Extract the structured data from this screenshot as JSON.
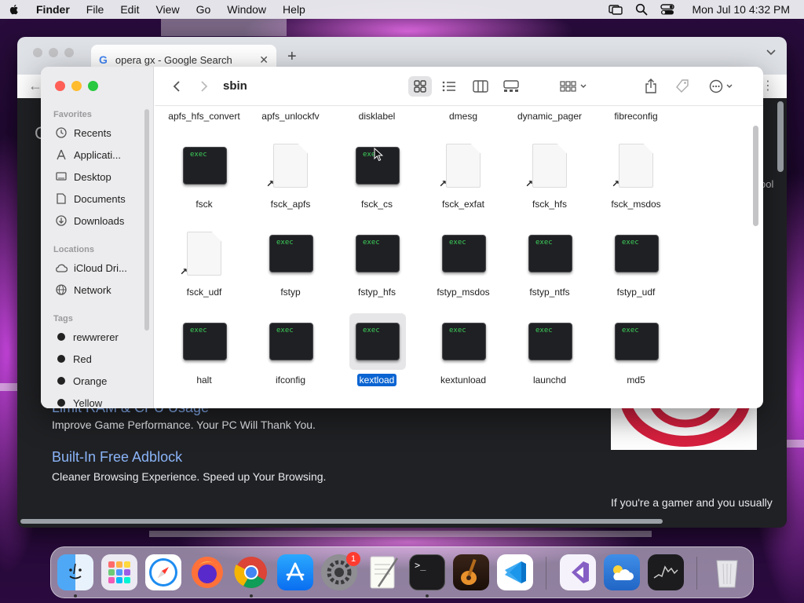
{
  "menubar": {
    "app_name": "Finder",
    "items": [
      "File",
      "Edit",
      "View",
      "Go",
      "Window",
      "Help"
    ],
    "clock": "Mon Jul 10  4:32 PM"
  },
  "browser": {
    "tab_title": "opera gx - Google Search",
    "ads": [
      {
        "title": "Limit RAM & CPU Usage",
        "desc": "Improve Game Performance. Your PC Will Thank You."
      },
      {
        "title": "Built-In Free Adblock",
        "desc": "Cleaner Browsing Experience. Speed up Your Browsing."
      }
    ],
    "side_text": "If you're a gamer and you usually"
  },
  "finder": {
    "title": "sbin",
    "sidebar": {
      "favorites_header": "Favorites",
      "favorites": [
        "Recents",
        "Applicati...",
        "Desktop",
        "Documents",
        "Downloads"
      ],
      "locations_header": "Locations",
      "locations": [
        "iCloud Dri...",
        "Network"
      ],
      "tags_header": "Tags",
      "tags": [
        {
          "name": "rewwrerer",
          "color": "#222222"
        },
        {
          "name": "Red",
          "color": "#222222"
        },
        {
          "name": "Orange",
          "color": "#222222"
        },
        {
          "name": "Yellow",
          "color": "#222222"
        }
      ]
    },
    "files_row0": [
      "apfs_hfs_convert",
      "apfs_unlockfv",
      "disklabel",
      "dmesg",
      "dynamic_pager",
      "fibreconfig"
    ],
    "files": [
      {
        "name": "fsck",
        "kind": "exec"
      },
      {
        "name": "fsck_apfs",
        "kind": "alias"
      },
      {
        "name": "fsck_cs",
        "kind": "exec"
      },
      {
        "name": "fsck_exfat",
        "kind": "alias"
      },
      {
        "name": "fsck_hfs",
        "kind": "alias"
      },
      {
        "name": "fsck_msdos",
        "kind": "alias"
      },
      {
        "name": "fsck_udf",
        "kind": "alias"
      },
      {
        "name": "fstyp",
        "kind": "exec"
      },
      {
        "name": "fstyp_hfs",
        "kind": "exec"
      },
      {
        "name": "fstyp_msdos",
        "kind": "exec"
      },
      {
        "name": "fstyp_ntfs",
        "kind": "exec"
      },
      {
        "name": "fstyp_udf",
        "kind": "exec"
      },
      {
        "name": "halt",
        "kind": "exec"
      },
      {
        "name": "ifconfig",
        "kind": "exec"
      },
      {
        "name": "kextload",
        "kind": "exec",
        "selected": true
      },
      {
        "name": "kextunload",
        "kind": "exec"
      },
      {
        "name": "launchd",
        "kind": "exec"
      },
      {
        "name": "md5",
        "kind": "exec"
      }
    ],
    "exec_label": "exec"
  },
  "dock": {
    "apps": [
      "finder",
      "launchpad",
      "safari",
      "firefox",
      "chrome",
      "app-store",
      "system-settings",
      "textedit",
      "terminal",
      "garageband",
      "vscode",
      "visual-studio",
      "weather",
      "stocks",
      "trash"
    ],
    "settings_badge": "1"
  }
}
